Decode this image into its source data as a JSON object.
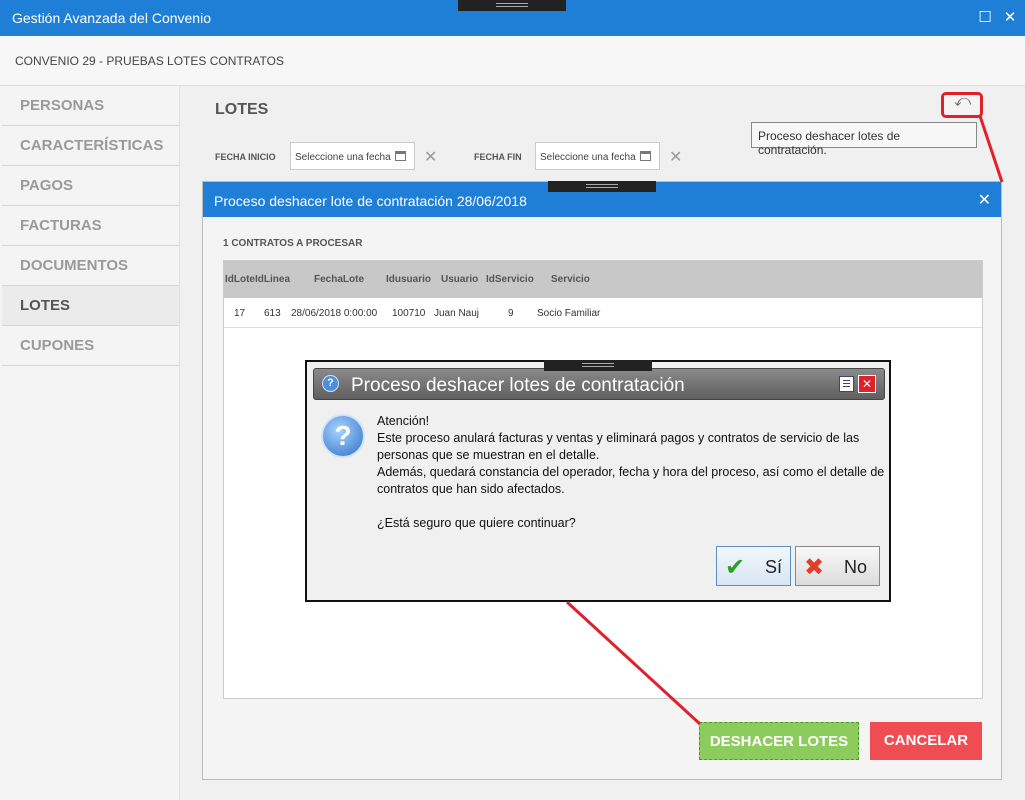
{
  "window": {
    "title": "Gestión Avanzada del Convenio",
    "maximize_glyph": "☐",
    "close_glyph": "✕"
  },
  "subheader": {
    "text": "CONVENIO 29 - PRUEBAS LOTES CONTRATOS"
  },
  "sidebar": {
    "items": [
      {
        "label": "PERSONAS"
      },
      {
        "label": "CARACTERÍSTICAS"
      },
      {
        "label": "PAGOS"
      },
      {
        "label": "FACTURAS"
      },
      {
        "label": "DOCUMENTOS"
      },
      {
        "label": "LOTES",
        "active": true
      },
      {
        "label": "CUPONES"
      }
    ]
  },
  "lotes": {
    "title": "LOTES",
    "fecha_inicio_label": "FECHA INICIO",
    "fecha_fin_label": "FECHA FIN",
    "date_placeholder": "Seleccione una fecha",
    "undo_glyph": "⤺",
    "tooltip": "Proceso deshacer lotes de contratación."
  },
  "dialog": {
    "title": "Proceso deshacer lote de contratación 28/06/2018",
    "close_glyph": "✕",
    "count_label": "1 CONTRATOS A PROCESAR",
    "columns": [
      "IdLote",
      "IdLinea",
      "FechaLote",
      "Idusuario",
      "Usuario",
      "IdServicio",
      "Servicio"
    ],
    "rows": [
      [
        "17",
        "613",
        "28/06/2018 0:00:00",
        "100710",
        "Juan Nauj",
        "9",
        "Socio Familiar"
      ]
    ],
    "deshacer_label": "DESHACER LOTES",
    "cancelar_label": "CANCELAR"
  },
  "msgbox": {
    "title": "Proceso deshacer lotes de contratación",
    "lines": [
      "Atención!",
      "Este proceso anulará facturas y ventas y eliminará pagos y contratos de servicio de las personas que se muestran en el detalle.",
      "Además, quedará constancia del operador, fecha y hora del proceso, así como el detalle de contratos que han sido afectados.",
      "",
      "¿Está seguro que quiere continuar?"
    ],
    "yes_label": "Sí",
    "no_label": "No"
  },
  "colors": {
    "accent": "#1f7fd6",
    "confirm_green": "#8ccc5c",
    "cancel_red": "#ef4d52",
    "annotation_red": "#e0202a"
  }
}
